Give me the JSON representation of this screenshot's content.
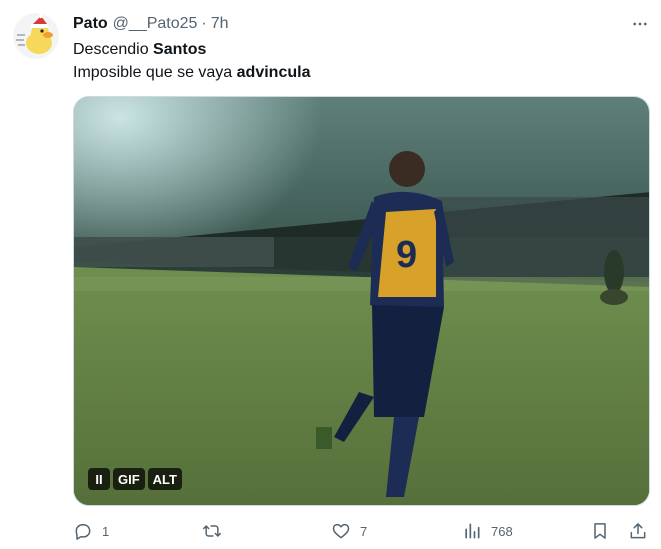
{
  "tweet": {
    "author": {
      "display_name": "Pato",
      "handle": "@__Pato25",
      "avatar_icon": "avatar-duck-santa-hat"
    },
    "separator": "·",
    "time": "7h",
    "more_icon": "more-dots-icon",
    "text": {
      "line1_prefix": "Descendio ",
      "line1_bold": "Santos",
      "line2_prefix": "Imposible que se vaya ",
      "line2_bold": "advincula"
    },
    "media": {
      "type": "gif",
      "pause_label": "II",
      "gif_label": "GIF",
      "alt_label": "ALT"
    },
    "actions": {
      "reply_count": "1",
      "retweet_count": "",
      "like_count": "7",
      "views_count": "768"
    }
  },
  "colors": {
    "text": "#0f1419",
    "secondary": "#536471",
    "border": "#cfd9de"
  }
}
